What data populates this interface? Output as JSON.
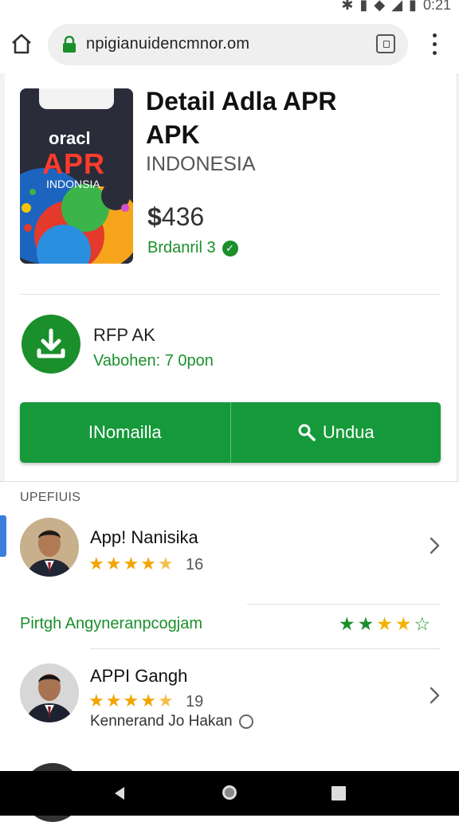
{
  "status": {
    "time": "0:21"
  },
  "browser": {
    "url": "npigianuidencmnor.om"
  },
  "app": {
    "title_line1": "Detail Adla APR",
    "title_line2": "APK",
    "region": "INDONESIA",
    "price_symbol": "$",
    "price_value": "436",
    "developer": "Brdanril 3",
    "icon_text_top": "oracl",
    "icon_text_brand": "APR",
    "icon_text_region": "INDONSIA"
  },
  "download": {
    "name": "RFP AK",
    "version": "Vabohen: 7 0pon",
    "button_left": "INomailla",
    "button_right": "Undua"
  },
  "reviews": {
    "section_label": "UPEFIUIS",
    "items": [
      {
        "name": "App! Nanisika",
        "count": "16",
        "rating": 4.5
      },
      {
        "name": "APPI Gangh",
        "count": "19",
        "rating": 4.5,
        "note": "Kennerand Jo Hakan"
      }
    ],
    "subsection": "Pirtgh Angyneranpcogjam",
    "subsection_rating": 4
  },
  "colors": {
    "accent_green": "#16993a",
    "star_orange": "#f2a400",
    "indicator_blue": "#3b7ddd"
  },
  "icons": {
    "home": "home-icon",
    "lock": "lock-icon",
    "tabs": "tabs-icon",
    "menu": "more-vert-icon",
    "download": "download-icon",
    "search": "search-icon",
    "chevron": "chevron-right-icon",
    "verified": "verified-icon"
  }
}
